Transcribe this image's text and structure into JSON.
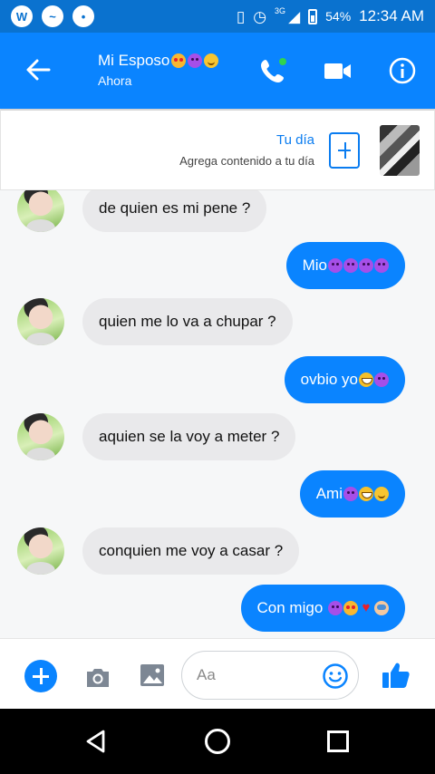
{
  "status_bar": {
    "network": "3G",
    "battery": "54%",
    "time": "12:34 AM"
  },
  "header": {
    "back_icon": "arrow-left-icon",
    "contact_name": "Mi Esposo",
    "name_emojis": [
      "heart-eyes",
      "smiling-devil",
      "smiling-face"
    ],
    "status": "Ahora",
    "actions": [
      "phone-icon",
      "video-camera-icon",
      "info-icon"
    ],
    "accent": "#0a84ff"
  },
  "story": {
    "title": "Tu día",
    "subtitle": "Agrega contenido a tu día"
  },
  "messages": [
    {
      "direction": "in",
      "text": "de quien es mi pene ?",
      "emojis": []
    },
    {
      "direction": "out",
      "text": "Mio",
      "emojis": [
        "smiling-devil",
        "smiling-devil",
        "smiling-devil",
        "smiling-devil"
      ]
    },
    {
      "direction": "in",
      "text": "quien me lo va a chupar ?",
      "emojis": []
    },
    {
      "direction": "out",
      "text": "ovbio yo",
      "emojis": [
        "laughing-face",
        "smiling-devil"
      ]
    },
    {
      "direction": "in",
      "text": "aquien se la voy a meter ?",
      "emojis": []
    },
    {
      "direction": "out",
      "text": "Ami",
      "emojis": [
        "smiling-devil",
        "laughing-face",
        "smiling-face"
      ]
    },
    {
      "direction": "in",
      "text": "conquien me voy a casar ?",
      "emojis": []
    },
    {
      "direction": "out",
      "text": "Con migo ",
      "emojis": [
        "smiling-devil",
        "heart-eyes",
        "red-heart",
        "hug-face"
      ]
    }
  ],
  "composer": {
    "placeholder": "Aa",
    "icons": [
      "plus-icon",
      "camera-icon",
      "gallery-icon",
      "emoji-icon",
      "thumbs-up-icon"
    ]
  }
}
